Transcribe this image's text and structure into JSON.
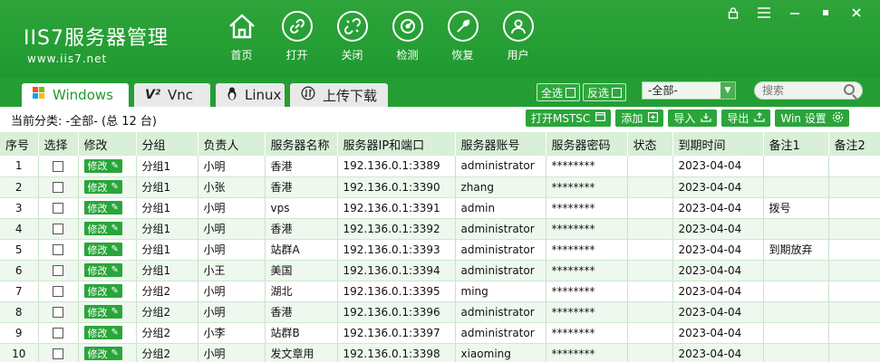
{
  "app": {
    "logo_text": "IIS7服务器管理",
    "logo_url": "www.iis7.net"
  },
  "nav": [
    {
      "label": "首页",
      "icon": "home-icon"
    },
    {
      "label": "打开",
      "icon": "link-icon"
    },
    {
      "label": "关闭",
      "icon": "broken-link-icon"
    },
    {
      "label": "检测",
      "icon": "speedometer-icon"
    },
    {
      "label": "恢复",
      "icon": "wrench-icon"
    },
    {
      "label": "用户",
      "icon": "user-icon"
    }
  ],
  "window_controls": [
    "lock-icon",
    "menu-icon",
    "minimize-icon",
    "maximize-icon",
    "close-icon"
  ],
  "tabs": [
    {
      "label": "Windows",
      "icon": "windows-icon",
      "active": true
    },
    {
      "label": "Vnc",
      "icon": "vnc-icon",
      "active": false
    },
    {
      "label": "Linux",
      "icon": "linux-icon",
      "active": false
    },
    {
      "label": "上传下载",
      "icon": "upload-download-icon",
      "active": false
    }
  ],
  "top_controls": {
    "select_all": "全选",
    "invert_select": "反选",
    "category_value": "-全部-",
    "search_placeholder": "搜索"
  },
  "toolbar": {
    "current_category": "当前分类:  -全部- (总 12 台)",
    "actions": [
      {
        "label": "打开MSTSC",
        "icon": "window-icon"
      },
      {
        "label": "添加",
        "icon": "add-icon"
      },
      {
        "label": "导入",
        "icon": "import-icon"
      },
      {
        "label": "导出",
        "icon": "export-icon"
      },
      {
        "label": "Win 设置",
        "icon": "gear-icon"
      }
    ]
  },
  "table": {
    "headers": [
      "序号",
      "选择",
      "修改",
      "分组",
      "负责人",
      "服务器名称",
      "服务器IP和端口",
      "服务器账号",
      "服务器密码",
      "状态",
      "到期时间",
      "备注1",
      "备注2"
    ],
    "edit_label": "修改",
    "rows": [
      {
        "no": "1",
        "group": "分组1",
        "owner": "小明",
        "name": "香港",
        "ip": "192.136.0.1:3389",
        "account": "administrator",
        "password": "********",
        "status": "",
        "expire": "2023-04-04",
        "note1": "",
        "note2": ""
      },
      {
        "no": "2",
        "group": "分组1",
        "owner": "小张",
        "name": "香港",
        "ip": "192.136.0.1:3390",
        "account": "zhang",
        "password": "********",
        "status": "",
        "expire": "2023-04-04",
        "note1": "",
        "note2": ""
      },
      {
        "no": "3",
        "group": "分组1",
        "owner": "小明",
        "name": "vps",
        "ip": "192.136.0.1:3391",
        "account": "admin",
        "password": "********",
        "status": "",
        "expire": "2023-04-04",
        "note1": "拨号",
        "note2": ""
      },
      {
        "no": "4",
        "group": "分组1",
        "owner": "小明",
        "name": "香港",
        "ip": "192.136.0.1:3392",
        "account": "administrator",
        "password": "********",
        "status": "",
        "expire": "2023-04-04",
        "note1": "",
        "note2": ""
      },
      {
        "no": "5",
        "group": "分组1",
        "owner": "小明",
        "name": "站群A",
        "ip": "192.136.0.1:3393",
        "account": "administrator",
        "password": "********",
        "status": "",
        "expire": "2023-04-04",
        "note1": "到期放弃",
        "note2": ""
      },
      {
        "no": "6",
        "group": "分组1",
        "owner": "小王",
        "name": "美国",
        "ip": "192.136.0.1:3394",
        "account": "administrator",
        "password": "********",
        "status": "",
        "expire": "2023-04-04",
        "note1": "",
        "note2": ""
      },
      {
        "no": "7",
        "group": "分组2",
        "owner": "小明",
        "name": "湖北",
        "ip": "192.136.0.1:3395",
        "account": "ming",
        "password": "********",
        "status": "",
        "expire": "2023-04-04",
        "note1": "",
        "note2": ""
      },
      {
        "no": "8",
        "group": "分组2",
        "owner": "小明",
        "name": "香港",
        "ip": "192.136.0.1:3396",
        "account": "administrator",
        "password": "********",
        "status": "",
        "expire": "2023-04-04",
        "note1": "",
        "note2": ""
      },
      {
        "no": "9",
        "group": "分组2",
        "owner": "小李",
        "name": "站群B",
        "ip": "192.136.0.1:3397",
        "account": "administrator",
        "password": "********",
        "status": "",
        "expire": "2023-04-04",
        "note1": "",
        "note2": ""
      },
      {
        "no": "10",
        "group": "分组2",
        "owner": "小明",
        "name": "发文章用",
        "ip": "192.136.0.1:3398",
        "account": "xiaoming",
        "password": "********",
        "status": "",
        "expire": "2023-04-04",
        "note1": "",
        "note2": ""
      }
    ]
  }
}
